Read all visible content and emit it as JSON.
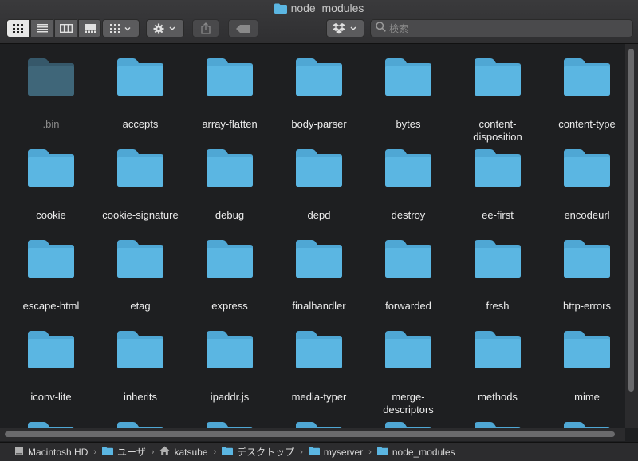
{
  "window": {
    "title": "node_modules"
  },
  "toolbar": {
    "view_buttons": [
      "icon-view",
      "list-view",
      "column-view",
      "gallery-view"
    ],
    "search_placeholder": "検索"
  },
  "files": [
    ".bin",
    "accepts",
    "array-flatten",
    "body-parser",
    "bytes",
    "content-\ndisposition",
    "content-type",
    "cookie",
    "cookie-signature",
    "debug",
    "depd",
    "destroy",
    "ee-first",
    "encodeurl",
    "escape-html",
    "etag",
    "express",
    "finalhandler",
    "forwarded",
    "fresh",
    "http-errors",
    "iconv-lite",
    "inherits",
    "ipaddr.js",
    "media-typer",
    "merge-\ndescriptors",
    "methods",
    "mime"
  ],
  "pathbar": [
    {
      "icon": "hard-drive-icon",
      "label": "Macintosh HD"
    },
    {
      "icon": "folder-icon",
      "label": "ユーザ"
    },
    {
      "icon": "home-icon",
      "label": "katsube"
    },
    {
      "icon": "folder-icon",
      "label": "デスクトップ"
    },
    {
      "icon": "folder-icon",
      "label": "myserver"
    },
    {
      "icon": "folder-icon",
      "label": "node_modules"
    }
  ],
  "colors": {
    "folder": "#5bb6e2",
    "folder_dim": "#3f6679",
    "background": "#1e1f21"
  }
}
